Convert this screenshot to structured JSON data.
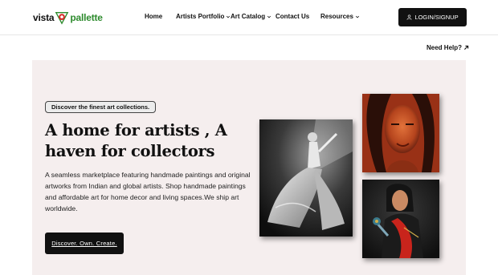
{
  "header": {
    "logo": {
      "part1": "vista",
      "part2": "pallette"
    },
    "nav": [
      {
        "label": "Home",
        "has_dropdown": false
      },
      {
        "label": "Artists Portfolio",
        "has_dropdown": true
      },
      {
        "label": "Art Catalog",
        "has_dropdown": true
      },
      {
        "label": "Contact Us",
        "has_dropdown": false
      },
      {
        "label": "Resources",
        "has_dropdown": true
      }
    ],
    "login_label": "LOGIN/SIGNUP"
  },
  "help_label": "Need Help?",
  "hero": {
    "pill": "Discover the finest art collections.",
    "headline": "A home for artists , A haven for collectors",
    "description": "A seamless marketplace featuring handmade paintings and original artworks from Indian and global artists. Shop handmade paintings and affordable art for home decor and living spaces.We ship art worldwide.",
    "cta_label": "Discover. Own. Create."
  },
  "colors": {
    "hero_bg": "#f5eeee",
    "button_bg": "#111111",
    "logo_green": "#2e8b2e",
    "logo_red": "#d62828"
  },
  "icons": [
    "user-icon",
    "arrow-up-right-icon",
    "chevron-down-icon",
    "palette-logo-icon"
  ]
}
